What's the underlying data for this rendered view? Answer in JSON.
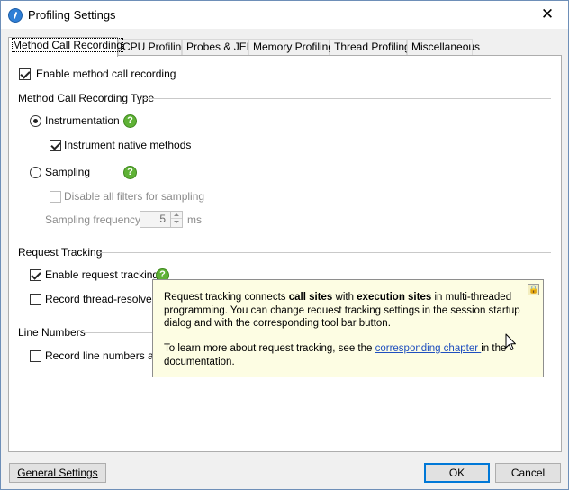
{
  "window": {
    "title": "Profiling Settings",
    "close_glyph": "✕",
    "app_icon": "profiler-app-icon"
  },
  "tabs": [
    {
      "label": "Method Call Recording",
      "active": true
    },
    {
      "label": "CPU Profiling",
      "active": false
    },
    {
      "label": "Probes & JEE",
      "active": false
    },
    {
      "label": "Memory Profiling",
      "active": false
    },
    {
      "label": "Thread Profiling",
      "active": false
    },
    {
      "label": "Miscellaneous",
      "active": false
    }
  ],
  "panel": {
    "enable_method_call_recording": {
      "label": "Enable method call recording",
      "checked": true
    },
    "recording_type_section": "Method Call Recording Type",
    "instrumentation": {
      "label": "Instrumentation",
      "selected": true
    },
    "instrument_native_methods": {
      "label": "Instrument native methods",
      "checked": true
    },
    "sampling": {
      "label": "Sampling",
      "selected": false
    },
    "disable_filters_for_sampling": {
      "label": "Disable all filters for sampling",
      "checked": false,
      "disabled": true
    },
    "sampling_frequency": {
      "label": "Sampling frequency:",
      "value": "5",
      "unit": "ms",
      "disabled": true
    },
    "request_tracking_section": "Request Tracking",
    "enable_request_tracking": {
      "label": "Enable request tracking",
      "checked": true
    },
    "record_thread_resolved": {
      "label": "Record thread-resolved c",
      "checked": false
    },
    "line_numbers_section": "Line Numbers",
    "record_line_numbers": {
      "label": "Record line numbers and",
      "checked": false
    },
    "help_glyph": "?"
  },
  "tooltip": {
    "p1_a": "Request tracking connects ",
    "p1_b": "call sites",
    "p1_c": " with ",
    "p1_d": "execution sites",
    "p1_e": " in multi-threaded programming. You can change request tracking settings in the session startup dialog and with the corresponding tool bar button.",
    "p2_a": "To learn more about request tracking, see the ",
    "p2_link": "corresponding chapter ",
    "p2_b": "in the documentation.",
    "lock_glyph": "🔒"
  },
  "footer": {
    "general_settings": "General Settings",
    "ok": "OK",
    "cancel": "Cancel"
  },
  "colors": {
    "accent": "#0078d7",
    "tooltip_bg": "#fdfde3",
    "help_icon": "#5fb236",
    "link": "#1f4fbf"
  }
}
